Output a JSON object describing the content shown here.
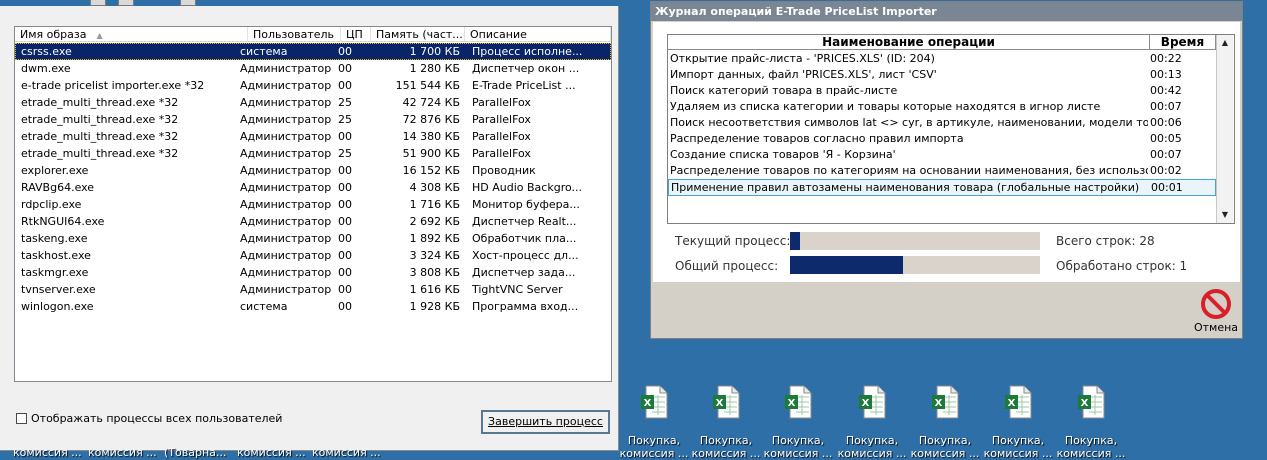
{
  "task_manager": {
    "columns": {
      "name": "Имя образа",
      "user": "Пользователь",
      "cpu": "ЦП",
      "memory": "Память (част...",
      "description": "Описание"
    },
    "processes": [
      {
        "name": "csrss.exe",
        "user": "система",
        "cpu": "00",
        "memory": "1 700 КБ",
        "description": "Процесс исполне..."
      },
      {
        "name": "dwm.exe",
        "user": "Администратор",
        "cpu": "00",
        "memory": "1 280 КБ",
        "description": "Диспетчер окон ..."
      },
      {
        "name": "e-trade pricelist importer.exe *32",
        "user": "Администратор",
        "cpu": "00",
        "memory": "151 544 КБ",
        "description": "E-Trade PriceList ..."
      },
      {
        "name": "etrade_multi_thread.exe *32",
        "user": "Администратор",
        "cpu": "25",
        "memory": "42 724 КБ",
        "description": "ParallelFox"
      },
      {
        "name": "etrade_multi_thread.exe *32",
        "user": "Администратор",
        "cpu": "25",
        "memory": "72 876 КБ",
        "description": "ParallelFox"
      },
      {
        "name": "etrade_multi_thread.exe *32",
        "user": "Администратор",
        "cpu": "00",
        "memory": "14 380 КБ",
        "description": "ParallelFox"
      },
      {
        "name": "etrade_multi_thread.exe *32",
        "user": "Администратор",
        "cpu": "25",
        "memory": "51 900 КБ",
        "description": "ParallelFox"
      },
      {
        "name": "explorer.exe",
        "user": "Администратор",
        "cpu": "00",
        "memory": "16 152 КБ",
        "description": "Проводник"
      },
      {
        "name": "RAVBg64.exe",
        "user": "Администратор",
        "cpu": "00",
        "memory": "4 308 КБ",
        "description": "HD Audio Backgro..."
      },
      {
        "name": "rdpclip.exe",
        "user": "Администратор",
        "cpu": "00",
        "memory": "1 716 КБ",
        "description": "Монитор буфера..."
      },
      {
        "name": "RtkNGUI64.exe",
        "user": "Администратор",
        "cpu": "00",
        "memory": "2 692 КБ",
        "description": "Диспетчер Realt..."
      },
      {
        "name": "taskeng.exe",
        "user": "Администратор",
        "cpu": "00",
        "memory": "1 892 КБ",
        "description": "Обработчик пла..."
      },
      {
        "name": "taskhost.exe",
        "user": "Администратор",
        "cpu": "00",
        "memory": "3 324 КБ",
        "description": "Хост-процесс дл..."
      },
      {
        "name": "taskmgr.exe",
        "user": "Администратор",
        "cpu": "00",
        "memory": "3 808 КБ",
        "description": "Диспетчер зада..."
      },
      {
        "name": "tvnserver.exe",
        "user": "Администратор",
        "cpu": "00",
        "memory": "1 616 КБ",
        "description": "TightVNC Server"
      },
      {
        "name": "winlogon.exe",
        "user": "система",
        "cpu": "00",
        "memory": "1 928 КБ",
        "description": "Программа вход..."
      }
    ],
    "show_all_label": "Отображать процессы всех пользователей",
    "end_process_label": "Завершить процесс"
  },
  "journal": {
    "title": "Журнал операций E-Trade PriceList Importer",
    "columns": {
      "operation": "Наименование операции",
      "time": "Время"
    },
    "rows": [
      {
        "operation": "Открытие прайс-листа - 'PRICES.XLS' (ID: 204)",
        "time": "00:22"
      },
      {
        "operation": "Импорт данных, файл 'PRICES.XLS', лист 'CSV'",
        "time": "00:13"
      },
      {
        "operation": "Поиск категорий товара в прайс-листе",
        "time": "00:42"
      },
      {
        "operation": "Удаляем из списка категории и товары которые находятся в игнор листе",
        "time": "00:07"
      },
      {
        "operation": "Поиск несоответствия символов lat <> cyr, в артикуле, наименовании, модели товара",
        "time": "00:06"
      },
      {
        "operation": "Распределение товаров согласно правил импорта",
        "time": "00:05"
      },
      {
        "operation": "Создание списка товаров 'Я - Корзина'",
        "time": "00:07"
      },
      {
        "operation": "Распределение товаров по категориям на основании наименования, без использования",
        "time": "00:02"
      },
      {
        "operation": "Применение правил автозамены наименования товара (глобальные настройки)",
        "time": "00:01"
      }
    ],
    "current_process_label": "Текущий процесс:",
    "overall_process_label": "Общий процесс:",
    "current_progress": 0.04,
    "overall_progress": 0.45,
    "total_rows_label": "Всего строк: 28",
    "processed_rows_label": "Обработано строк: 1",
    "cancel_label": "Отмена"
  },
  "desktop": {
    "icons": [
      {
        "line1": "Покупка,",
        "line2": "комиссия ..."
      },
      {
        "line1": "Покупка,",
        "line2": "комиссия ..."
      },
      {
        "line1": "Покупка,",
        "line2": "комиссия ..."
      },
      {
        "line1": "Покупка,",
        "line2": "комиссия ..."
      },
      {
        "line1": "Покупка,",
        "line2": "комиссия ..."
      },
      {
        "line1": "Покупка,",
        "line2": "комиссия ..."
      },
      {
        "line1": "Покупка,",
        "line2": "комиссия ..."
      }
    ],
    "bottom_labels": [
      "комиссия ...",
      "комиссия ...",
      "(Товарна...",
      "комиссия ...",
      "комиссия ..."
    ]
  },
  "colors": {
    "desktop": "#2f6fa8",
    "selection": "#0a246a",
    "progress": "#0d2a6c",
    "excel_green": "#1d7a3a"
  }
}
